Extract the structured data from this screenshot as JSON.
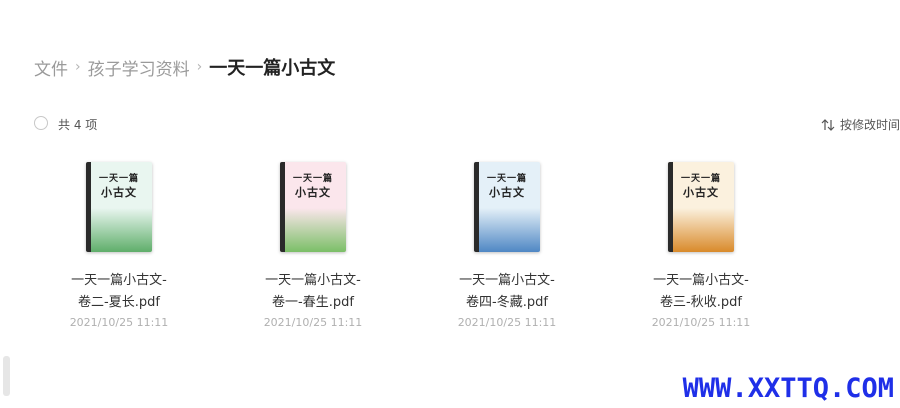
{
  "breadcrumb": {
    "items": [
      "文件",
      "孩子学习资料"
    ],
    "current": "一天一篇小古文"
  },
  "toolbar": {
    "count_text": "共 4 项",
    "sort_label": "按修改时间"
  },
  "cover": {
    "title": "一天一篇",
    "subtitle": "小古文"
  },
  "files": [
    {
      "name_line1": "一天一篇小古文-",
      "name_line2": "卷二-夏长.pdf",
      "date": "2021/10/25 11:11",
      "cover_color": "#e9f6f0",
      "illus_color": "#5fae6a"
    },
    {
      "name_line1": "一天一篇小古文-",
      "name_line2": "卷一-春生.pdf",
      "date": "2021/10/25 11:11",
      "cover_color": "#fbe6ec",
      "illus_color": "#7bbf67"
    },
    {
      "name_line1": "一天一篇小古文-",
      "name_line2": "卷四-冬藏.pdf",
      "date": "2021/10/25 11:11",
      "cover_color": "#e4f0f8",
      "illus_color": "#4f87c4"
    },
    {
      "name_line1": "一天一篇小古文-",
      "name_line2": "卷三-秋收.pdf",
      "date": "2021/10/25 11:11",
      "cover_color": "#fbf1de",
      "illus_color": "#d98a2b"
    }
  ],
  "watermark": "WWW.XXTTQ.COM"
}
